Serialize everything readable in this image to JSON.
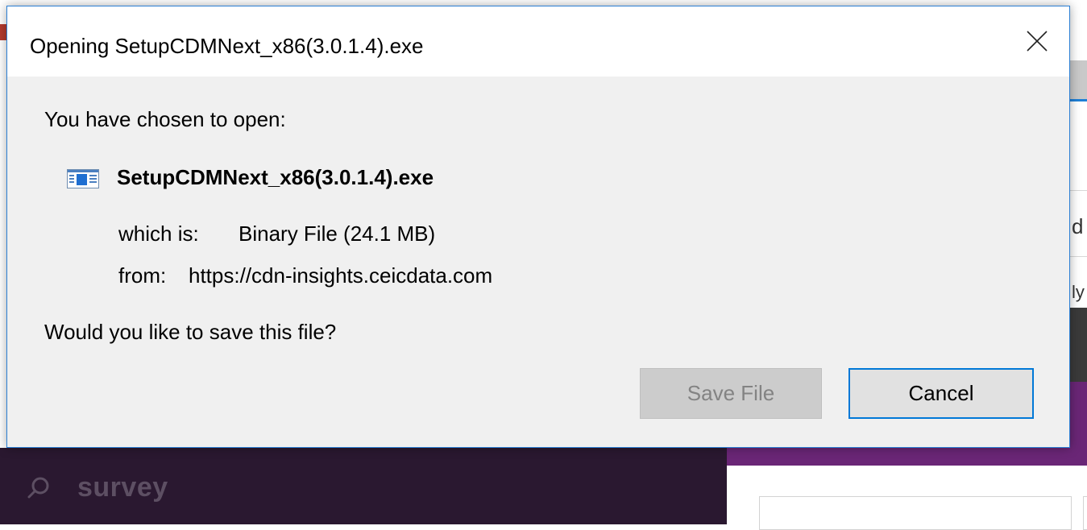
{
  "dialog": {
    "title": "Opening SetupCDMNext_x86(3.0.1.4).exe",
    "prompt": "You have chosen to open:",
    "file_name": "SetupCDMNext_x86(3.0.1.4).exe",
    "type_label": "which is:",
    "type_value": "Binary File (24.1 MB)",
    "from_label": "from:",
    "from_value": "https://cdn-insights.ceicdata.com",
    "question": "Would you like to save this file?",
    "save_label": "Save File",
    "cancel_label": "Cancel",
    "close_icon": "close-icon",
    "file_icon": "application-icon",
    "accent_color": "#0078d7"
  },
  "background": {
    "search_text": "survey",
    "search_icon": "search-icon",
    "fragment_1": "d",
    "fragment_2": "ly",
    "colors": {
      "search_panel": "#2a1830",
      "purple_band": "#6a2676"
    }
  }
}
